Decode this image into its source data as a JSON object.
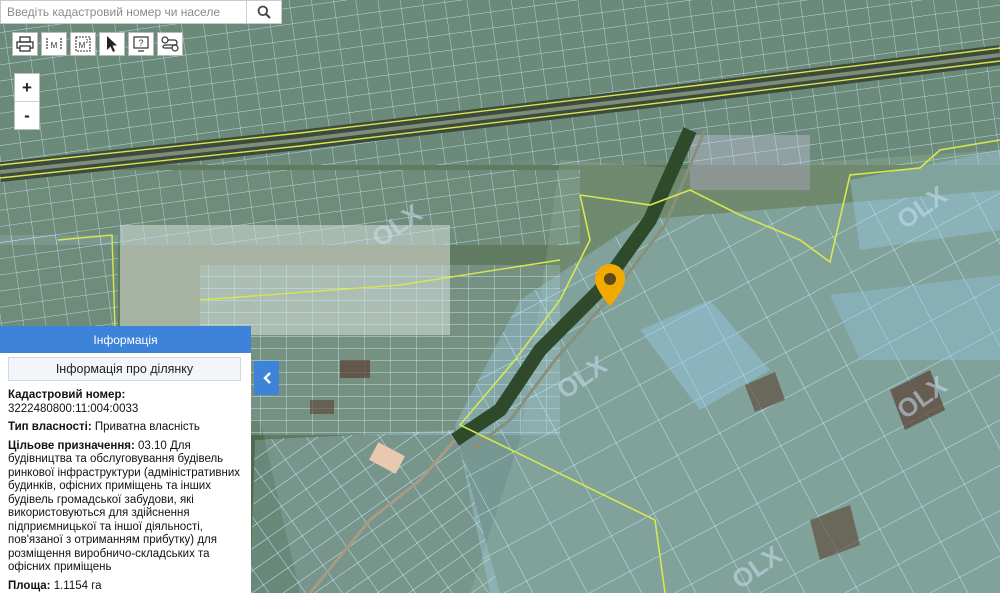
{
  "search": {
    "placeholder": "Введіть кадастровий номер чи населе",
    "value": "",
    "button_icon": "search-icon"
  },
  "toolbar": {
    "tools": [
      {
        "name": "print-icon"
      },
      {
        "name": "measure-distance-icon",
        "glyph": "M"
      },
      {
        "name": "measure-area-icon",
        "glyph": "M²"
      },
      {
        "name": "select-pointer-icon"
      },
      {
        "name": "identify-icon",
        "glyph": "?"
      },
      {
        "name": "layers-toggle-icon"
      }
    ]
  },
  "zoom": {
    "in": "+",
    "out": "-"
  },
  "info_panel": {
    "header": "Інформація",
    "subheader": "Інформація про ділянку",
    "cadastral_label": "Кадастровий номер:",
    "cadastral_value": "3222480800:11:004:0033",
    "ownership_label": "Тип власності:",
    "ownership_value": "Приватна власність",
    "purpose_label": "Цільове призначення:",
    "purpose_value": "03.10 Для будівництва та обслуговування будівель ринкової інфраструктури (адміністративних будинків, офісних приміщень та інших будівель громадської забудови, які використовуються для здійснення підприємницької та іншої діяльності, пов'язаної з отриманням прибутку) для розміщення виробничо-складських та офісних приміщень",
    "area_label": "Площа:",
    "area_value": "1.1154 га"
  },
  "colors": {
    "parcel_fill": "#a9d3f0",
    "parcel_stroke": "#b8e2ff",
    "boundary": "#d7e84f",
    "marker": "#f2a900",
    "panel_header": "#3c83d9"
  }
}
